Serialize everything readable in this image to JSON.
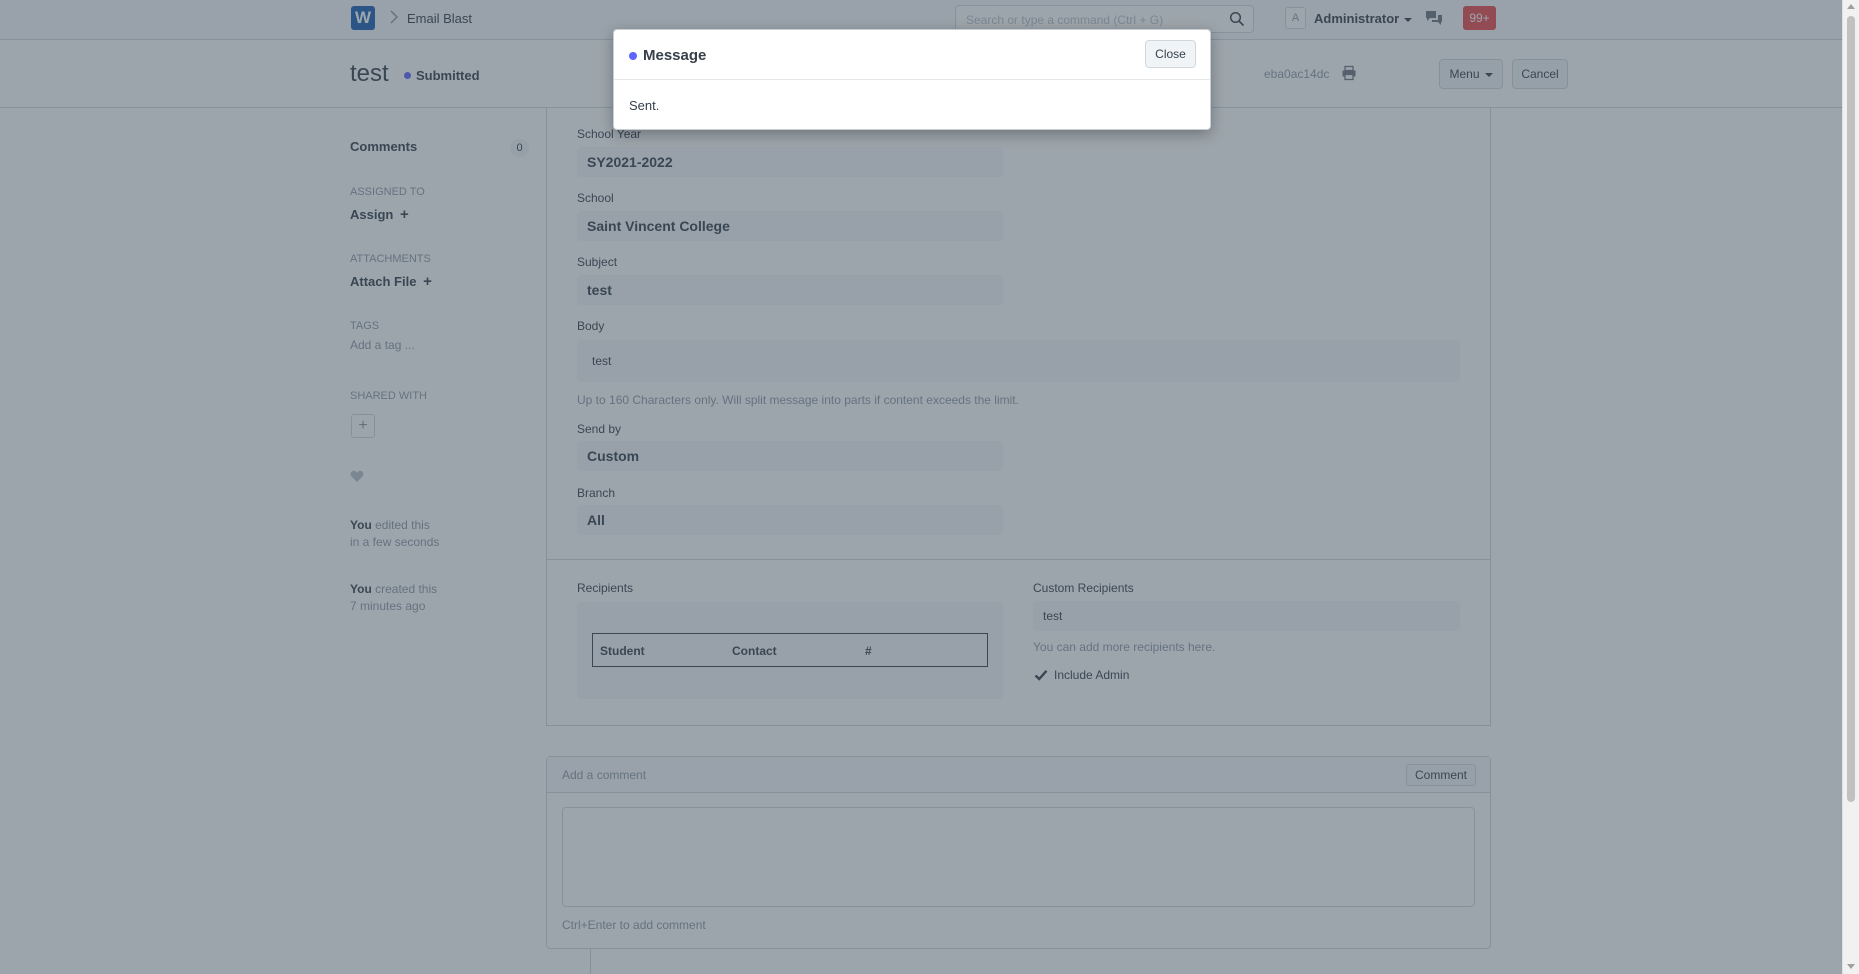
{
  "navbar": {
    "logo": "W",
    "breadcrumb": "Email Blast",
    "search_placeholder": "Search or type a command (Ctrl + G)",
    "avatar": "A",
    "user": "Administrator",
    "notifications": "99+"
  },
  "page_head": {
    "title": "test",
    "status": "Submitted",
    "docname": "eba0ac14dc",
    "menu_label": "Menu",
    "cancel_label": "Cancel"
  },
  "sidebar": {
    "comments_label": "Comments",
    "comments_count": "0",
    "assigned_to": "ASSIGNED TO",
    "assign": "Assign",
    "attachments": "ATTACHMENTS",
    "attach_file": "Attach File",
    "tags": "TAGS",
    "add_tag": "Add a tag ...",
    "shared_with": "SHARED WITH",
    "edited_by": "You",
    "edited_action": " edited this",
    "edited_when": "in a few seconds",
    "created_by": "You",
    "created_action": " created this",
    "created_when": "7 minutes ago"
  },
  "form": {
    "school_year_label": "School Year",
    "school_year_value": "SY2021-2022",
    "school_label": "School",
    "school_value": "Saint Vincent College",
    "subject_label": "Subject",
    "subject_value": "test",
    "body_label": "Body",
    "body_value": "test",
    "body_help": "Up to 160 Characters only. Will split message into parts if content exceeds the limit.",
    "send_by_label": "Send by",
    "send_by_value": "Custom",
    "branch_label": "Branch",
    "branch_value": "All",
    "recipients_label": "Recipients",
    "grid_headers": [
      "Student",
      "Contact",
      "#"
    ],
    "custom_recipients_label": "Custom Recipients",
    "custom_recipients_value": "test",
    "custom_recipients_help": "You can add more recipients here.",
    "include_admin_label": "Include Admin"
  },
  "comment": {
    "title": "Add a comment",
    "button": "Comment",
    "hint": "Ctrl+Enter to add comment"
  },
  "modal": {
    "title": "Message",
    "close": "Close",
    "body": "Sent."
  },
  "colors": {
    "accent": "#5e64ff",
    "notification": "#e8494d",
    "logo": "#1a5fb4"
  }
}
